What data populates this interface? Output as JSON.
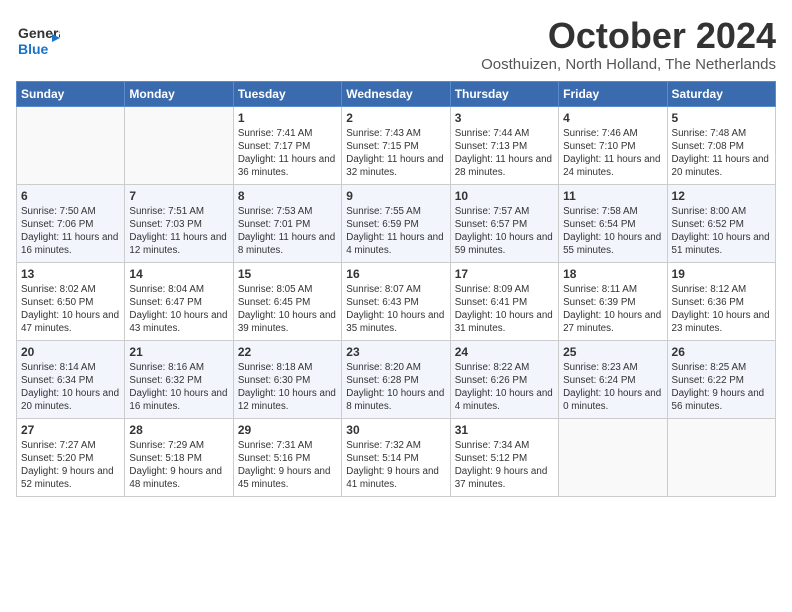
{
  "header": {
    "logo_line1": "General",
    "logo_line2": "Blue",
    "month": "October 2024",
    "location": "Oosthuizen, North Holland, The Netherlands"
  },
  "weekdays": [
    "Sunday",
    "Monday",
    "Tuesday",
    "Wednesday",
    "Thursday",
    "Friday",
    "Saturday"
  ],
  "weeks": [
    [
      {
        "day": "",
        "sunrise": "",
        "sunset": "",
        "daylight": ""
      },
      {
        "day": "",
        "sunrise": "",
        "sunset": "",
        "daylight": ""
      },
      {
        "day": "1",
        "sunrise": "Sunrise: 7:41 AM",
        "sunset": "Sunset: 7:17 PM",
        "daylight": "Daylight: 11 hours and 36 minutes."
      },
      {
        "day": "2",
        "sunrise": "Sunrise: 7:43 AM",
        "sunset": "Sunset: 7:15 PM",
        "daylight": "Daylight: 11 hours and 32 minutes."
      },
      {
        "day": "3",
        "sunrise": "Sunrise: 7:44 AM",
        "sunset": "Sunset: 7:13 PM",
        "daylight": "Daylight: 11 hours and 28 minutes."
      },
      {
        "day": "4",
        "sunrise": "Sunrise: 7:46 AM",
        "sunset": "Sunset: 7:10 PM",
        "daylight": "Daylight: 11 hours and 24 minutes."
      },
      {
        "day": "5",
        "sunrise": "Sunrise: 7:48 AM",
        "sunset": "Sunset: 7:08 PM",
        "daylight": "Daylight: 11 hours and 20 minutes."
      }
    ],
    [
      {
        "day": "6",
        "sunrise": "Sunrise: 7:50 AM",
        "sunset": "Sunset: 7:06 PM",
        "daylight": "Daylight: 11 hours and 16 minutes."
      },
      {
        "day": "7",
        "sunrise": "Sunrise: 7:51 AM",
        "sunset": "Sunset: 7:03 PM",
        "daylight": "Daylight: 11 hours and 12 minutes."
      },
      {
        "day": "8",
        "sunrise": "Sunrise: 7:53 AM",
        "sunset": "Sunset: 7:01 PM",
        "daylight": "Daylight: 11 hours and 8 minutes."
      },
      {
        "day": "9",
        "sunrise": "Sunrise: 7:55 AM",
        "sunset": "Sunset: 6:59 PM",
        "daylight": "Daylight: 11 hours and 4 minutes."
      },
      {
        "day": "10",
        "sunrise": "Sunrise: 7:57 AM",
        "sunset": "Sunset: 6:57 PM",
        "daylight": "Daylight: 10 hours and 59 minutes."
      },
      {
        "day": "11",
        "sunrise": "Sunrise: 7:58 AM",
        "sunset": "Sunset: 6:54 PM",
        "daylight": "Daylight: 10 hours and 55 minutes."
      },
      {
        "day": "12",
        "sunrise": "Sunrise: 8:00 AM",
        "sunset": "Sunset: 6:52 PM",
        "daylight": "Daylight: 10 hours and 51 minutes."
      }
    ],
    [
      {
        "day": "13",
        "sunrise": "Sunrise: 8:02 AM",
        "sunset": "Sunset: 6:50 PM",
        "daylight": "Daylight: 10 hours and 47 minutes."
      },
      {
        "day": "14",
        "sunrise": "Sunrise: 8:04 AM",
        "sunset": "Sunset: 6:47 PM",
        "daylight": "Daylight: 10 hours and 43 minutes."
      },
      {
        "day": "15",
        "sunrise": "Sunrise: 8:05 AM",
        "sunset": "Sunset: 6:45 PM",
        "daylight": "Daylight: 10 hours and 39 minutes."
      },
      {
        "day": "16",
        "sunrise": "Sunrise: 8:07 AM",
        "sunset": "Sunset: 6:43 PM",
        "daylight": "Daylight: 10 hours and 35 minutes."
      },
      {
        "day": "17",
        "sunrise": "Sunrise: 8:09 AM",
        "sunset": "Sunset: 6:41 PM",
        "daylight": "Daylight: 10 hours and 31 minutes."
      },
      {
        "day": "18",
        "sunrise": "Sunrise: 8:11 AM",
        "sunset": "Sunset: 6:39 PM",
        "daylight": "Daylight: 10 hours and 27 minutes."
      },
      {
        "day": "19",
        "sunrise": "Sunrise: 8:12 AM",
        "sunset": "Sunset: 6:36 PM",
        "daylight": "Daylight: 10 hours and 23 minutes."
      }
    ],
    [
      {
        "day": "20",
        "sunrise": "Sunrise: 8:14 AM",
        "sunset": "Sunset: 6:34 PM",
        "daylight": "Daylight: 10 hours and 20 minutes."
      },
      {
        "day": "21",
        "sunrise": "Sunrise: 8:16 AM",
        "sunset": "Sunset: 6:32 PM",
        "daylight": "Daylight: 10 hours and 16 minutes."
      },
      {
        "day": "22",
        "sunrise": "Sunrise: 8:18 AM",
        "sunset": "Sunset: 6:30 PM",
        "daylight": "Daylight: 10 hours and 12 minutes."
      },
      {
        "day": "23",
        "sunrise": "Sunrise: 8:20 AM",
        "sunset": "Sunset: 6:28 PM",
        "daylight": "Daylight: 10 hours and 8 minutes."
      },
      {
        "day": "24",
        "sunrise": "Sunrise: 8:22 AM",
        "sunset": "Sunset: 6:26 PM",
        "daylight": "Daylight: 10 hours and 4 minutes."
      },
      {
        "day": "25",
        "sunrise": "Sunrise: 8:23 AM",
        "sunset": "Sunset: 6:24 PM",
        "daylight": "Daylight: 10 hours and 0 minutes."
      },
      {
        "day": "26",
        "sunrise": "Sunrise: 8:25 AM",
        "sunset": "Sunset: 6:22 PM",
        "daylight": "Daylight: 9 hours and 56 minutes."
      }
    ],
    [
      {
        "day": "27",
        "sunrise": "Sunrise: 7:27 AM",
        "sunset": "Sunset: 5:20 PM",
        "daylight": "Daylight: 9 hours and 52 minutes."
      },
      {
        "day": "28",
        "sunrise": "Sunrise: 7:29 AM",
        "sunset": "Sunset: 5:18 PM",
        "daylight": "Daylight: 9 hours and 48 minutes."
      },
      {
        "day": "29",
        "sunrise": "Sunrise: 7:31 AM",
        "sunset": "Sunset: 5:16 PM",
        "daylight": "Daylight: 9 hours and 45 minutes."
      },
      {
        "day": "30",
        "sunrise": "Sunrise: 7:32 AM",
        "sunset": "Sunset: 5:14 PM",
        "daylight": "Daylight: 9 hours and 41 minutes."
      },
      {
        "day": "31",
        "sunrise": "Sunrise: 7:34 AM",
        "sunset": "Sunset: 5:12 PM",
        "daylight": "Daylight: 9 hours and 37 minutes."
      },
      {
        "day": "",
        "sunrise": "",
        "sunset": "",
        "daylight": ""
      },
      {
        "day": "",
        "sunrise": "",
        "sunset": "",
        "daylight": ""
      }
    ]
  ]
}
